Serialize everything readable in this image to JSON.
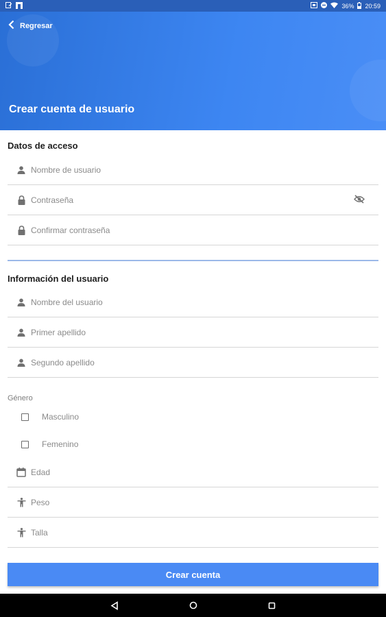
{
  "status_bar": {
    "battery": "36%",
    "time": "20:59"
  },
  "header": {
    "back_label": "Regresar",
    "title": "Crear cuenta de usuario"
  },
  "access_section": {
    "title": "Datos de acceso",
    "username_placeholder": "Nombre de usuario",
    "password_placeholder": "Contraseña",
    "confirm_placeholder": "Confirmar contraseña"
  },
  "user_section": {
    "title": "Información del usuario",
    "name_placeholder": "Nombre del usuario",
    "first_lastname_placeholder": "Primer apellido",
    "second_lastname_placeholder": "Segundo apellido",
    "gender_label": "Género",
    "gender_options": [
      "Masculino",
      "Femenino"
    ],
    "age_placeholder": "Edad",
    "weight_placeholder": "Peso",
    "height_placeholder": "Talla"
  },
  "submit_label": "Crear cuenta",
  "colors": {
    "accent": "#4a8af4",
    "header": "#3d86f2",
    "statusbar": "#2a5fb8"
  },
  "icons": {
    "back": "chevron-left-icon",
    "person": "person-icon",
    "lock": "lock-icon",
    "eye": "eye-off-icon",
    "calendar": "calendar-icon",
    "body": "accessibility-icon"
  }
}
